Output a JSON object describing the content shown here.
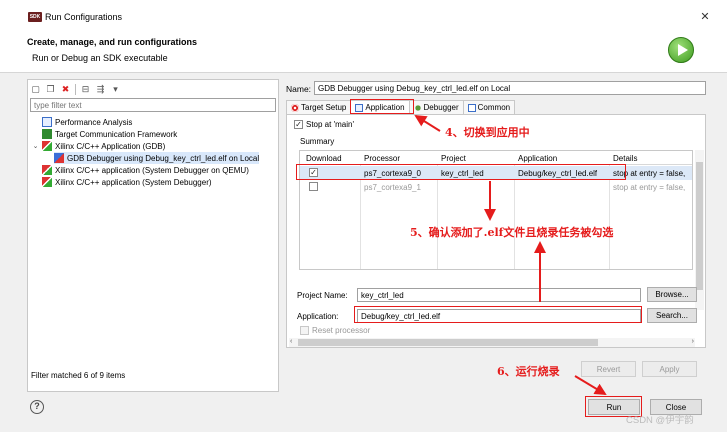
{
  "window": {
    "app_icon_text": "SDK",
    "title": "Run Configurations",
    "close_glyph": "✕"
  },
  "banner": {
    "title": "Create, manage, and run configurations",
    "subtitle": "Run or Debug an SDK executable"
  },
  "left": {
    "filter_placeholder": "type filter text",
    "tree": [
      {
        "label": "Performance Analysis",
        "icon": "performance-icon"
      },
      {
        "label": "Target Communication Framework",
        "icon": "tcf-icon"
      },
      {
        "label": "Xilinx C/C++ Application (GDB)",
        "icon": "xilinx-app-icon",
        "expanded": true
      },
      {
        "label": "GDB Debugger using Debug_key_ctrl_led.elf on Local",
        "icon": "gdb-config-icon",
        "selected": true
      },
      {
        "label": "Xilinx C/C++ application (System Debugger on QEMU)",
        "icon": "xilinx-app-icon"
      },
      {
        "label": "Xilinx C/C++ application (System Debugger)",
        "icon": "xilinx-app-icon"
      }
    ],
    "status": "Filter matched 6 of 9 items"
  },
  "right": {
    "name_label": "Name:",
    "name_value": "GDB Debugger using Debug_key_ctrl_led.elf on Local",
    "tabs": [
      {
        "label": "Target Setup",
        "icon": "target-icon"
      },
      {
        "label": "Application",
        "icon": "application-icon",
        "active": true
      },
      {
        "label": "Debugger",
        "icon": "debugger-icon"
      },
      {
        "label": "Common",
        "icon": "common-icon"
      }
    ],
    "stop_at_main": "Stop at 'main'",
    "summary_label": "Summary",
    "table": {
      "headers": [
        "Download",
        "Processor",
        "Project",
        "Application",
        "Details"
      ],
      "rows": [
        {
          "checked": true,
          "processor": "ps7_cortexa9_0",
          "project": "key_ctrl_led",
          "application": "Debug/key_ctrl_led.elf",
          "details": "stop at entry = false,"
        },
        {
          "checked": false,
          "processor": "ps7_cortexa9_1",
          "project": "",
          "application": "",
          "details": "stop at entry = false,"
        }
      ]
    },
    "project_name_label": "Project Name:",
    "project_name_value": "key_ctrl_led",
    "browse_label": "Browse...",
    "application_label": "Application:",
    "application_value": "Debug/key_ctrl_led.elf",
    "search_label": "Search...",
    "reset_processor": "Reset processor",
    "revert_label": "Revert",
    "apply_label": "Apply"
  },
  "bottom": {
    "help_glyph": "?",
    "run_label": "Run",
    "close_label": "Close"
  },
  "annotations": {
    "step4": "4、切换到应用中",
    "step5": "5、确认添加了.elf文件且烧录任务被勾选",
    "step6": "6、运行烧录",
    "color": "#e51c1c"
  },
  "watermark": "CSDN @伊宇韵"
}
